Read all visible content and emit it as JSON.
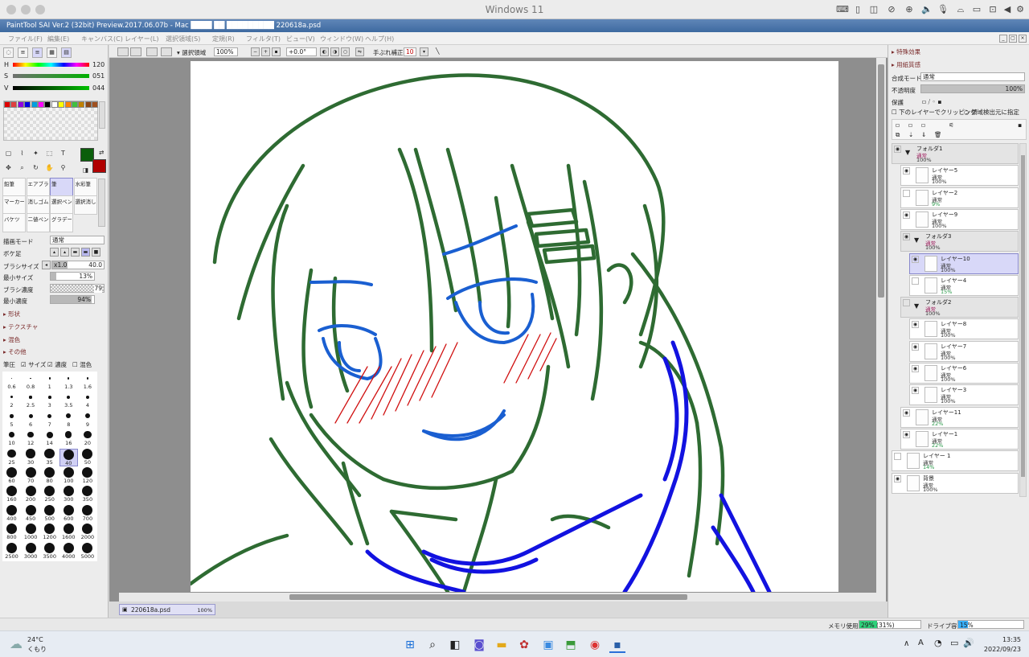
{
  "mac": {
    "title": "Windows 11"
  },
  "app": {
    "title": "PaintTool SAI Ver.2 (32bit) Preview.2017.06.07b - Mac ████ ██ █████████ 220618a.psd"
  },
  "menu": [
    "ファイル(F)",
    "編集(E)",
    "キャンバス(C)",
    "レイヤー(L)",
    "選択領域(S)",
    "定規(R)",
    "フィルタ(T)",
    "ビュー(V)",
    "ウィンドウ(W)",
    "ヘルプ(H)"
  ],
  "color": {
    "h_label": "H",
    "h_value": "120",
    "s_label": "S",
    "s_value": "051",
    "v_label": "V",
    "v_value": "044",
    "main_color": "#0b5e0b",
    "sub_color": "#b00000",
    "swatches": [
      "#e00000",
      "#e04040",
      "#9000e0",
      "#0000e0",
      "#00a0e0",
      "#ff00ff",
      "#000000",
      "#ffffff",
      "#ffff00",
      "#ff8000",
      "#40c040",
      "#c08000",
      "#8b4513",
      "#a05020"
    ]
  },
  "brushes": [
    {
      "name": "鉛筆",
      "selected": false
    },
    {
      "name": "エアブラシ",
      "selected": false
    },
    {
      "name": "筆",
      "selected": true
    },
    {
      "name": "水彩筆",
      "selected": false
    },
    {
      "name": "マーカー",
      "selected": false
    },
    {
      "name": "消しゴム",
      "selected": false
    },
    {
      "name": "選択ペン",
      "selected": false
    },
    {
      "name": "選択消し",
      "selected": false
    },
    {
      "name": "バケツ",
      "selected": false
    },
    {
      "name": "二値ペン",
      "selected": false
    },
    {
      "name": "グラデーション",
      "selected": false
    }
  ],
  "brush_settings": {
    "draw_mode_label": "描画モード",
    "draw_mode_value": "通常",
    "edge_label": "ボケ足",
    "size_label": "ブラシサイズ",
    "size_mult": "x1.0",
    "size_value": "40.0",
    "min_size_label": "最小サイズ",
    "min_size_value": "13%",
    "min_size_fraction": 0.13,
    "density_label": "ブラシ濃度",
    "density_value": "79",
    "density_fraction": 0.79,
    "min_density_label": "最小濃度",
    "min_density_value": "94%",
    "min_density_fraction": 0.94,
    "sections": [
      "形状",
      "テクスチャ",
      "混色",
      "その他"
    ],
    "pressure_label": "筆圧",
    "pressure_opts": [
      "サイズ",
      "濃度",
      "混色"
    ],
    "sizes": [
      "0.6",
      "0.8",
      "1",
      "1.3",
      "1.6",
      "2",
      "2.5",
      "3",
      "3.5",
      "4",
      "5",
      "6",
      "7",
      "8",
      "9",
      "10",
      "12",
      "14",
      "16",
      "20",
      "25",
      "30",
      "35",
      "40",
      "50",
      "60",
      "70",
      "80",
      "100",
      "120",
      "160",
      "200",
      "250",
      "300",
      "350",
      "400",
      "450",
      "500",
      "600",
      "700",
      "800",
      "1000",
      "1200",
      "1600",
      "2000",
      "2500",
      "3000",
      "3500",
      "4000",
      "5000"
    ],
    "selected_size": "40"
  },
  "canvas_toolbar": {
    "selection_label": "選択領域",
    "zoom": "100%",
    "angle": "+0.0°",
    "stabilizer_label": "手ぶれ補正",
    "stabilizer_value": "10"
  },
  "document_tab": {
    "name": "220618a.psd",
    "zoom": "100%"
  },
  "right": {
    "special_effects": "特殊効果",
    "paper_texture": "用紙質感",
    "blend_mode_label": "合成モード",
    "blend_mode_value": "通常",
    "opacity_label": "不透明度",
    "opacity_value": "100%",
    "protect_label": "保護",
    "clip_label": "下のレイヤーでクリッピング",
    "region_label": "領域検出元に指定"
  },
  "layers": [
    {
      "name": "フォルダ1",
      "mode": "通常",
      "opacity": "100%",
      "folder": true,
      "level": 0,
      "selected": false,
      "visible": true
    },
    {
      "name": "レイヤー5",
      "mode": "通常",
      "opacity": "100%",
      "folder": false,
      "level": 1,
      "selected": false,
      "visible": true
    },
    {
      "name": "レイヤー2",
      "mode": "通常",
      "opacity": "9%",
      "folder": false,
      "level": 1,
      "selected": false,
      "visible": false
    },
    {
      "name": "レイヤー9",
      "mode": "通常",
      "opacity": "100%",
      "folder": false,
      "level": 1,
      "selected": false,
      "visible": true
    },
    {
      "name": "フォルダ3",
      "mode": "通常",
      "opacity": "100%",
      "folder": true,
      "level": 1,
      "selected": false,
      "visible": true
    },
    {
      "name": "レイヤー10",
      "mode": "通常",
      "opacity": "100%",
      "folder": false,
      "level": 2,
      "selected": true,
      "visible": true
    },
    {
      "name": "レイヤー4",
      "mode": "通常",
      "opacity": "15%",
      "folder": false,
      "level": 2,
      "selected": false,
      "visible": false
    },
    {
      "name": "フォルダ2",
      "mode": "通常",
      "opacity": "100%",
      "folder": true,
      "level": 1,
      "selected": false,
      "visible": false
    },
    {
      "name": "レイヤー8",
      "mode": "通常",
      "opacity": "100%",
      "folder": false,
      "level": 2,
      "selected": false,
      "visible": true
    },
    {
      "name": "レイヤー7",
      "mode": "通常",
      "opacity": "100%",
      "folder": false,
      "level": 2,
      "selected": false,
      "visible": true
    },
    {
      "name": "レイヤー6",
      "mode": "通常",
      "opacity": "100%",
      "folder": false,
      "level": 2,
      "selected": false,
      "visible": true
    },
    {
      "name": "レイヤー3",
      "mode": "通常",
      "opacity": "100%",
      "folder": false,
      "level": 2,
      "selected": false,
      "visible": true
    },
    {
      "name": "レイヤー11",
      "mode": "通常",
      "opacity": "22%",
      "folder": false,
      "level": 1,
      "selected": false,
      "visible": true
    },
    {
      "name": "レイヤー1",
      "mode": "通常",
      "opacity": "22%",
      "folder": false,
      "level": 1,
      "selected": false,
      "visible": true
    },
    {
      "name": "レイヤー 1",
      "mode": "通常",
      "opacity": "14%",
      "folder": false,
      "level": 0,
      "selected": false,
      "visible": false
    },
    {
      "name": "背景",
      "mode": "通常",
      "opacity": "100%",
      "folder": false,
      "level": 0,
      "selected": false,
      "visible": true
    }
  ],
  "status": {
    "memory_label": "メモリ使用量",
    "memory_value": "29% (31%)",
    "memory_fraction": 0.29,
    "drive_label": "ドライブ容量",
    "drive_value": "15%",
    "drive_fraction": 0.15
  },
  "taskbar": {
    "temp": "24°C",
    "weather": "くもり",
    "time": "13:35",
    "date": "2022/09/23",
    "ime": "A"
  }
}
